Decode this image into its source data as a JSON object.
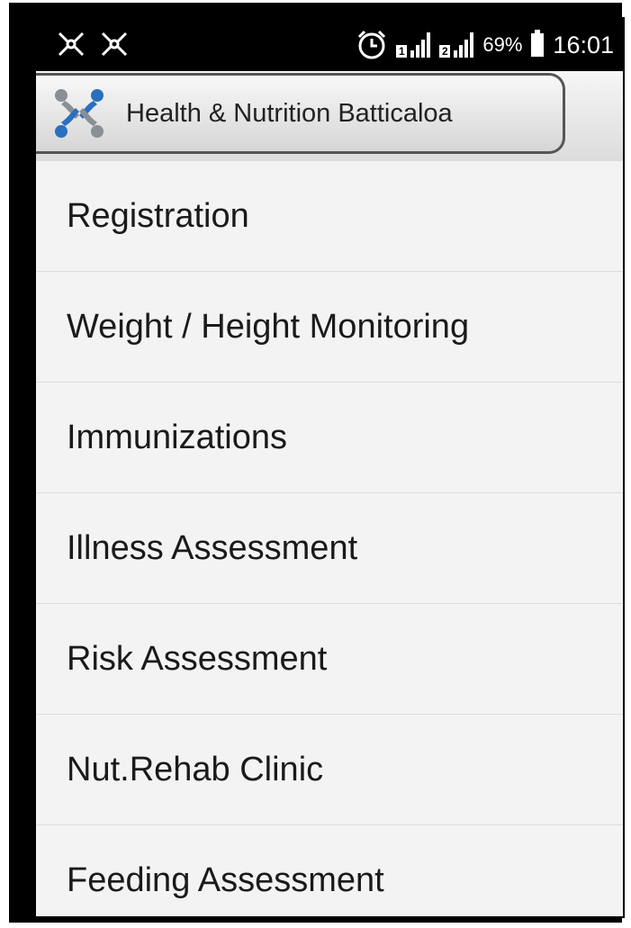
{
  "status_bar": {
    "left_icons": [
      "notification-icon",
      "notification-icon"
    ],
    "alarm_icon": "alarm-clock-icon",
    "sim1_label": "1",
    "sim2_label": "2",
    "network_type": "H",
    "battery_percent": "69%",
    "time": "16:01"
  },
  "action_bar": {
    "title": "Health & Nutrition Batticaloa",
    "logo_icon": "app-logo-icon"
  },
  "menu": {
    "items": [
      {
        "label": "Registration"
      },
      {
        "label": "Weight / Height Monitoring"
      },
      {
        "label": "Immunizations"
      },
      {
        "label": "Illness Assessment"
      },
      {
        "label": "Risk Assessment"
      },
      {
        "label": "Nut.Rehab Clinic"
      },
      {
        "label": "Feeding Assessment"
      }
    ]
  },
  "colors": {
    "status_bar_bg": "#000000",
    "background": "#f2f2f2",
    "logo_blue": "#2a6fc0",
    "logo_gray": "#8a8f95"
  }
}
